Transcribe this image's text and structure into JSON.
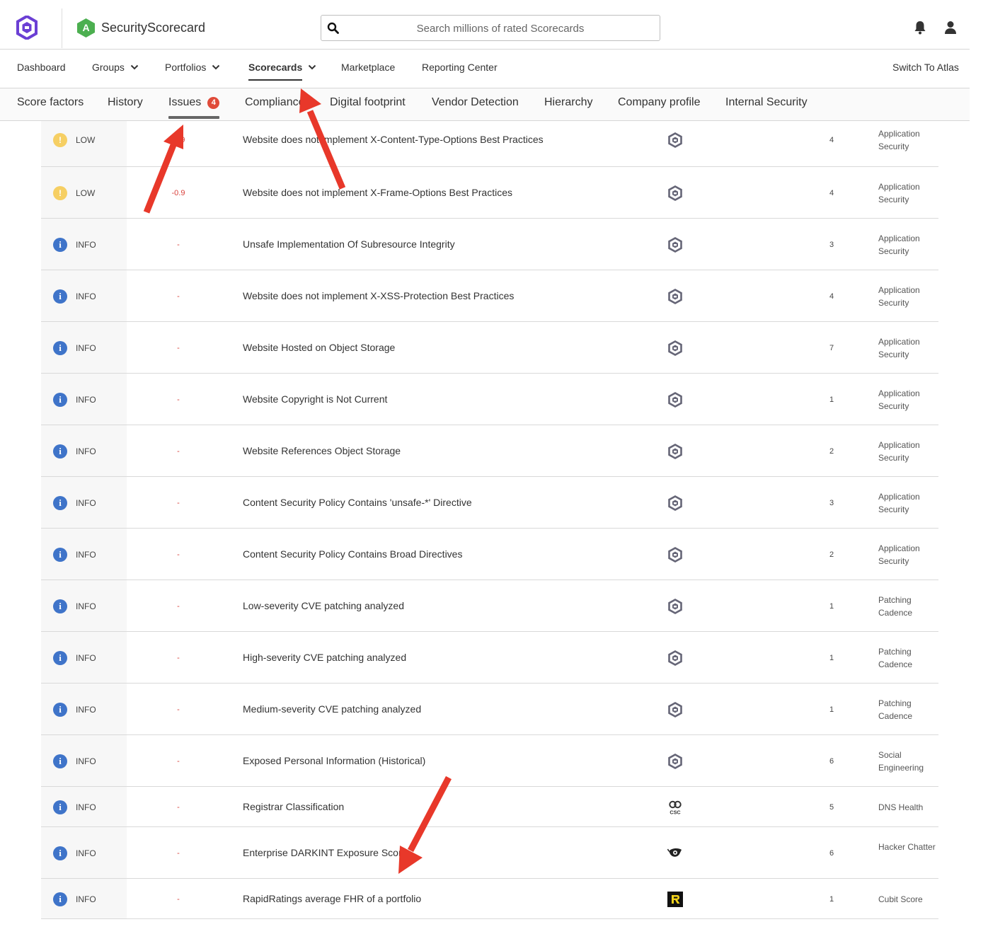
{
  "header": {
    "company_grade": "A",
    "company_name": "SecurityScorecard",
    "search_placeholder": "Search millions of rated Scorecards"
  },
  "nav": {
    "items": [
      "Dashboard",
      "Groups",
      "Portfolios",
      "Scorecards",
      "Marketplace",
      "Reporting Center"
    ],
    "switch_label": "Switch To Atlas",
    "active": "Scorecards"
  },
  "tabs": {
    "items": [
      "Score factors",
      "History",
      "Issues",
      "Compliance",
      "Digital footprint",
      "Vendor Detection",
      "Hierarchy",
      "Company profile",
      "Internal Security"
    ],
    "issues_badge": "4",
    "active": "Issues"
  },
  "issues": [
    {
      "severity": "LOW",
      "impact": "-0.9",
      "title": "Website does not implement X-Content-Type-Options Best Practices",
      "source": "ssc-hex-icon",
      "count": "4",
      "factor": "Application Security"
    },
    {
      "severity": "LOW",
      "impact": "-0.9",
      "title": "Website does not implement X-Frame-Options Best Practices",
      "source": "ssc-hex-icon",
      "count": "4",
      "factor": "Application Security"
    },
    {
      "severity": "INFO",
      "impact": "-",
      "title": "Unsafe Implementation Of Subresource Integrity",
      "source": "ssc-hex-icon",
      "count": "3",
      "factor": "Application Security"
    },
    {
      "severity": "INFO",
      "impact": "-",
      "title": "Website does not implement X-XSS-Protection Best Practices",
      "source": "ssc-hex-icon",
      "count": "4",
      "factor": "Application Security"
    },
    {
      "severity": "INFO",
      "impact": "-",
      "title": "Website Hosted on Object Storage",
      "source": "ssc-hex-icon",
      "count": "7",
      "factor": "Application Security"
    },
    {
      "severity": "INFO",
      "impact": "-",
      "title": "Website Copyright is Not Current",
      "source": "ssc-hex-icon",
      "count": "1",
      "factor": "Application Security"
    },
    {
      "severity": "INFO",
      "impact": "-",
      "title": "Website References Object Storage",
      "source": "ssc-hex-icon",
      "count": "2",
      "factor": "Application Security"
    },
    {
      "severity": "INFO",
      "impact": "-",
      "title": "Content Security Policy Contains 'unsafe-*' Directive",
      "source": "ssc-hex-icon",
      "count": "3",
      "factor": "Application Security"
    },
    {
      "severity": "INFO",
      "impact": "-",
      "title": "Content Security Policy Contains Broad Directives",
      "source": "ssc-hex-icon",
      "count": "2",
      "factor": "Application Security"
    },
    {
      "severity": "INFO",
      "impact": "-",
      "title": "Low-severity CVE patching analyzed",
      "source": "ssc-hex-icon",
      "count": "1",
      "factor": "Patching Cadence"
    },
    {
      "severity": "INFO",
      "impact": "-",
      "title": "High-severity CVE patching analyzed",
      "source": "ssc-hex-icon",
      "count": "1",
      "factor": "Patching Cadence"
    },
    {
      "severity": "INFO",
      "impact": "-",
      "title": "Medium-severity CVE patching analyzed",
      "source": "ssc-hex-icon",
      "count": "1",
      "factor": "Patching Cadence"
    },
    {
      "severity": "INFO",
      "impact": "-",
      "title": "Exposed Personal Information (Historical)",
      "source": "ssc-hex-icon",
      "count": "6",
      "factor": "Social Engineering"
    },
    {
      "severity": "INFO",
      "impact": "-",
      "title": "Registrar Classification",
      "source": "csc-icon",
      "count": "5",
      "factor": "DNS Health"
    },
    {
      "severity": "INFO",
      "impact": "-",
      "title": "Enterprise DARKINT Exposure Score",
      "source": "darkint-eye-icon",
      "count": "6",
      "factor": "Hacker Chatter"
    },
    {
      "severity": "INFO",
      "impact": "-",
      "title": "RapidRatings average FHR of a portfolio",
      "source": "rapidratings-icon",
      "count": "1",
      "factor": "Cubit Score"
    }
  ],
  "colors": {
    "brand_purple": "#6b3fd4",
    "grade_green": "#4caf50",
    "low_yellow": "#f6cf63",
    "info_blue": "#3f74c9",
    "impact_red": "#d9403b",
    "badge_red": "#e04b3a",
    "arrow_red": "#e8382a"
  }
}
